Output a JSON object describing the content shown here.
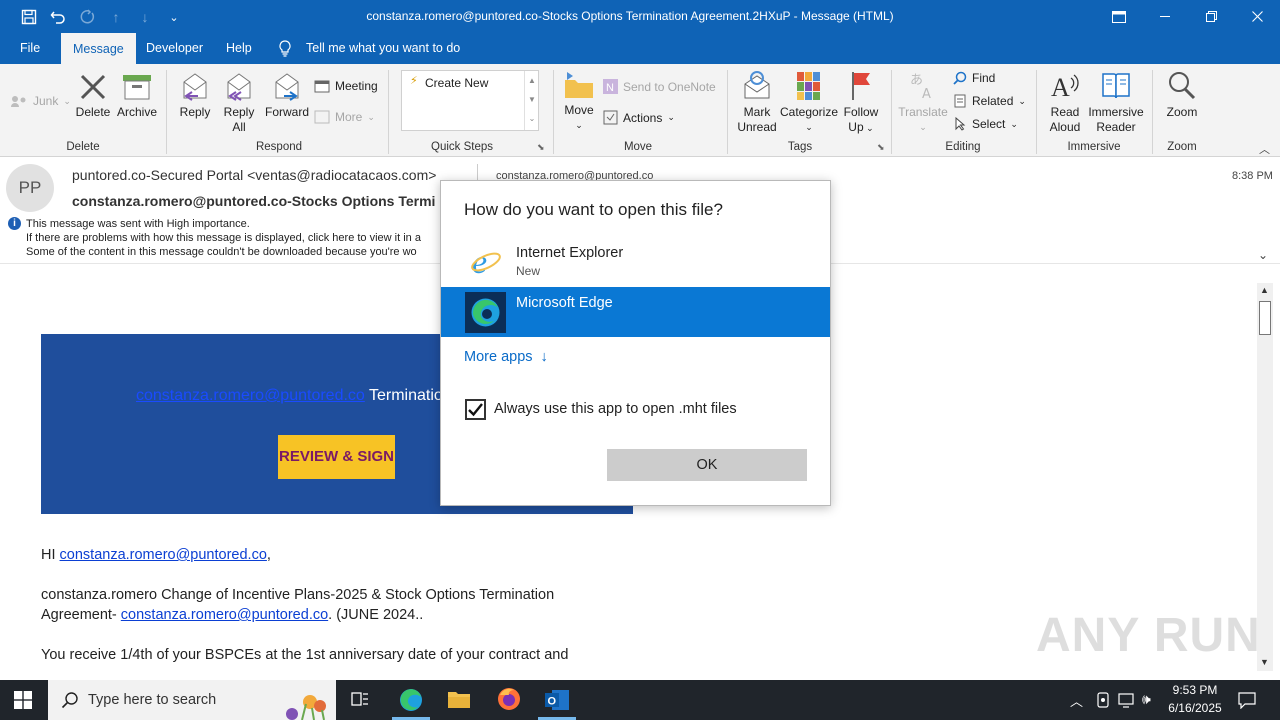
{
  "titlebar": {
    "title": "constanza.romero@puntored.co-Stocks Options Termination Agreement.2HXuP  -  Message (HTML)"
  },
  "tabs": [
    {
      "label": "File"
    },
    {
      "label": "Message"
    },
    {
      "label": "Developer"
    },
    {
      "label": "Help"
    }
  ],
  "tell_me": "Tell me what you want to do",
  "ribbon": {
    "junk": "Junk",
    "delete": "Delete",
    "archive": "Archive",
    "delete_group": "Delete",
    "reply": "Reply",
    "reply_all_1": "Reply",
    "reply_all_2": "All",
    "forward": "Forward",
    "meeting": "Meeting",
    "more": "More",
    "respond_group": "Respond",
    "create_new": "Create New",
    "quicksteps_group": "Quick Steps",
    "move": "Move",
    "send_onenote": "Send to OneNote",
    "actions": "Actions",
    "move_group": "Move",
    "mark_unread_1": "Mark",
    "mark_unread_2": "Unread",
    "categorize": "Categorize",
    "follow_up_1": "Follow",
    "follow_up_2": "Up",
    "tags_group": "Tags",
    "translate": "Translate",
    "find": "Find",
    "related": "Related",
    "select": "Select",
    "editing_group": "Editing",
    "read_aloud_1": "Read",
    "read_aloud_2": "Aloud",
    "immersive_1": "Immersive",
    "immersive_2": "Reader",
    "immersive_group": "Immersive",
    "zoom": "Zoom",
    "zoom_group": "Zoom"
  },
  "message": {
    "avatar_initials": "PP",
    "from": "puntored.co-Secured Portal <ventas@radiocatacaos.com>",
    "to": "constanza.romero@puntored.co",
    "time": "8:38 PM",
    "subject": "constanza.romero@puntored.co-Stocks Options Termi",
    "info1": "This message was sent with High importance.",
    "info2": "If there are problems with how this message is displayed, click here to view it in a",
    "info3": "Some of the content in this message couldn't be downloaded because you're wo"
  },
  "body": {
    "banner_link": "constanza.romero@puntored.co",
    "banner_text": " Terminatio",
    "review_btn": "REVIEW & SIGN",
    "greeting_prefix": "HI ",
    "greeting_link": "constanza.romero@puntored.co",
    "greeting_suffix": ",",
    "para1_line1": "constanza.romero Change of Incentive Plans-2025 & Stock Options Termination",
    "para1_line2_prefix": "Agreement- ",
    "para1_link": "constanza.romero@puntored.co",
    "para1_suffix": ". (JUNE 2024..",
    "para2": "You receive 1/4th of your BSPCEs at the 1st anniversary date of your contract and"
  },
  "dialog": {
    "heading": "How do you want to open this file?",
    "options": [
      {
        "name": "Internet Explorer",
        "sub": "New"
      },
      {
        "name": "Microsoft Edge",
        "sub": ""
      }
    ],
    "more_apps": "More apps",
    "checkbox_label": "Always use this app to open .mht files",
    "checkbox_checked": true,
    "ok": "OK"
  },
  "taskbar": {
    "search_placeholder": "Type here to search",
    "time": "9:53 PM",
    "date": "6/16/2025"
  },
  "watermark": "ANY RUN",
  "colors": {
    "accent": "#0f63b6",
    "banner": "#1f4e9c",
    "review_btn": "#f7c325",
    "selection": "#0a78d4"
  }
}
